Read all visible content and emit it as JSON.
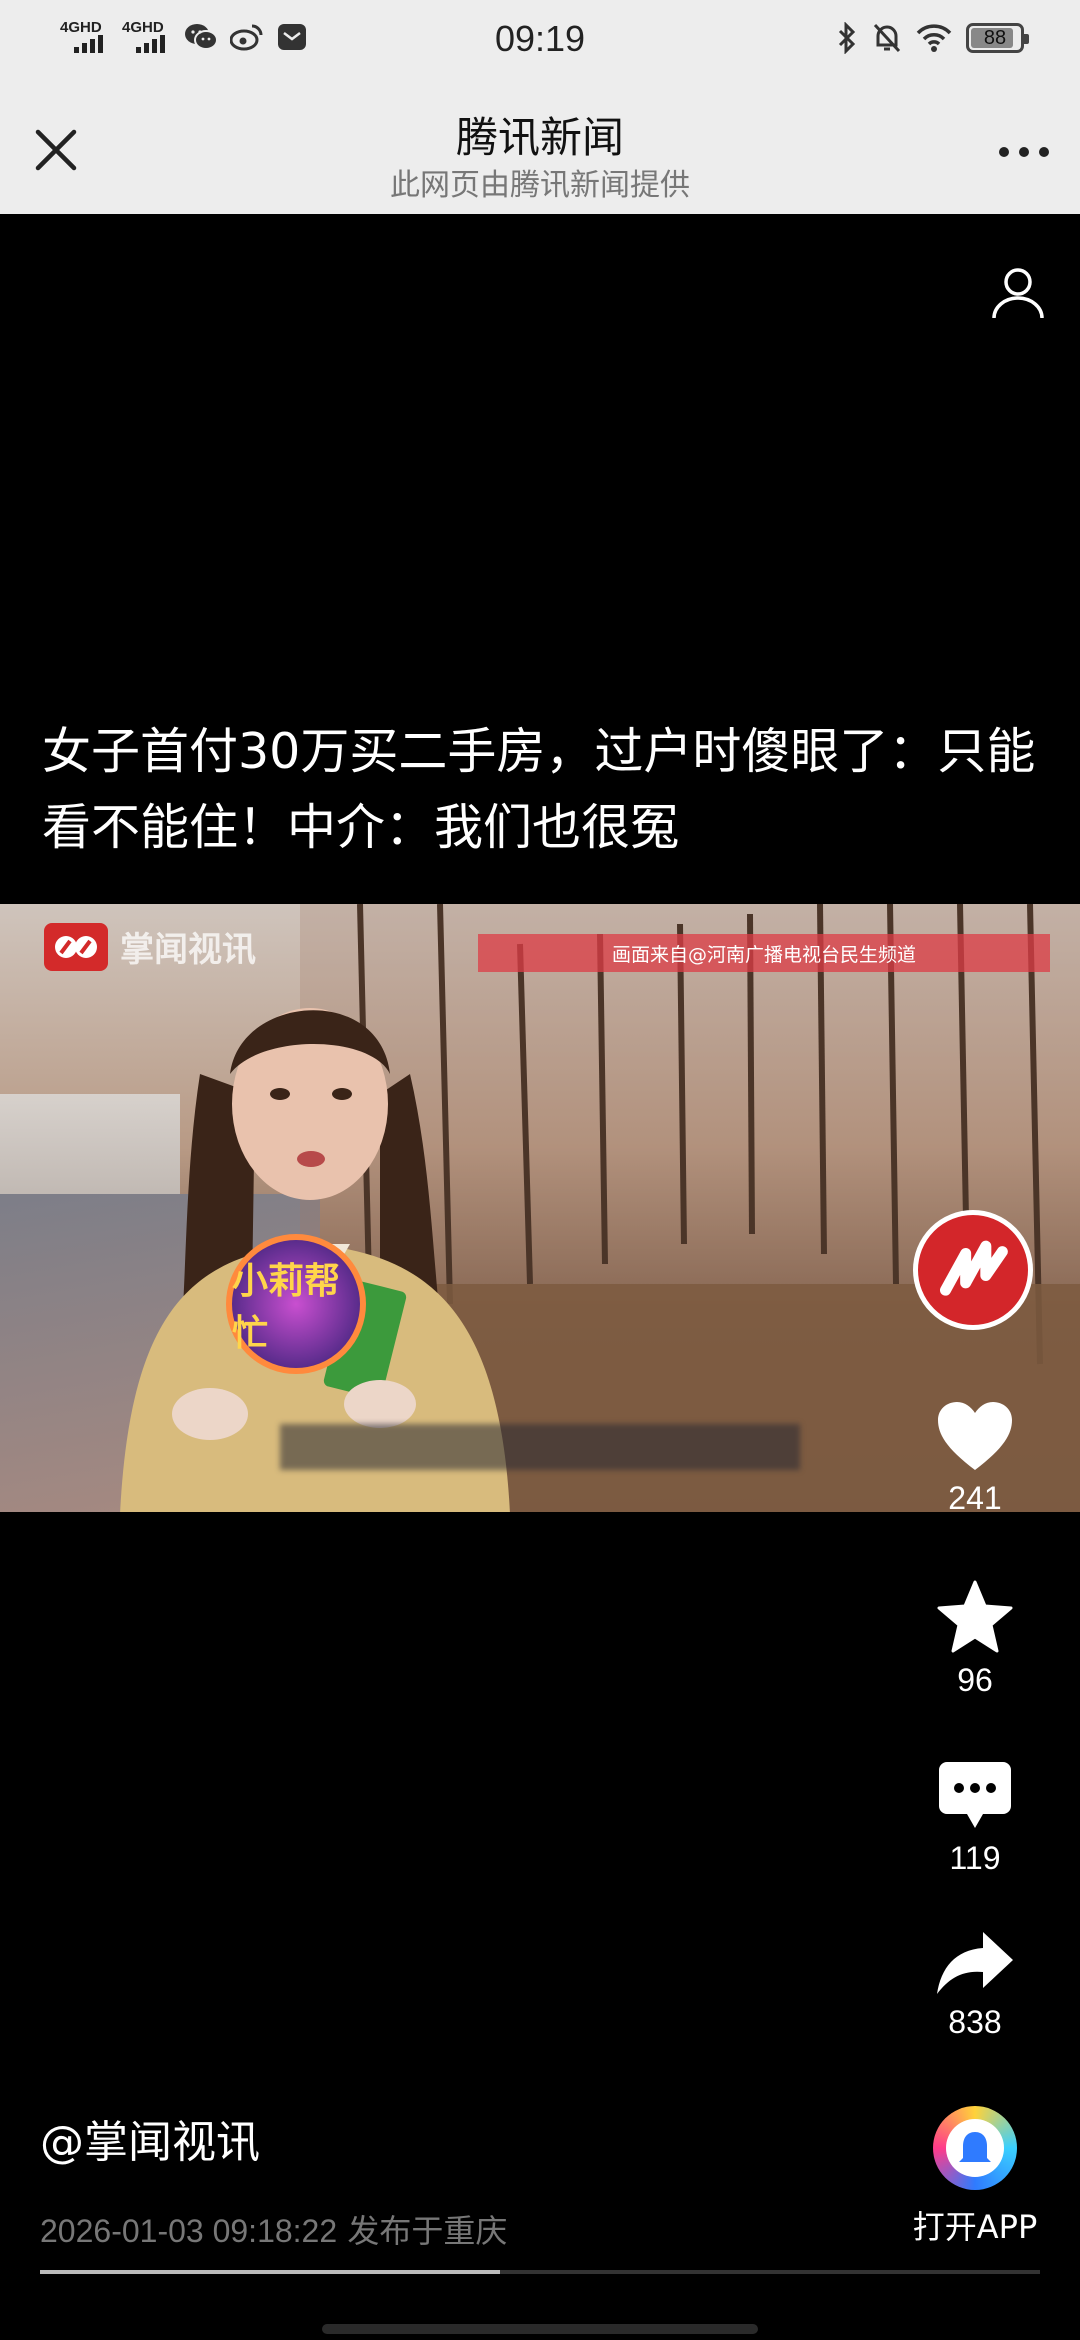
{
  "status_bar": {
    "time": "09:19",
    "signal_1": "4GHD",
    "signal_2": "4GHD",
    "battery": "88",
    "left_icons": [
      "wechat-icon",
      "weibo-icon",
      "message-icon"
    ],
    "right_icons": [
      "bluetooth-icon",
      "mute-icon",
      "wifi-icon",
      "battery-icon"
    ]
  },
  "nav": {
    "title": "腾讯新闻",
    "subtitle": "此网页由腾讯新闻提供"
  },
  "article": {
    "headline": "女子首付30万买二手房，过户时傻眼了：只能看不能住！中介：我们也很冤",
    "author": "@掌闻视讯",
    "date": "2026-01-03 09:18:22",
    "location": "发布于重庆"
  },
  "video": {
    "logo_text": "掌闻视讯",
    "source_banner": "画面来自@河南广播电视台民生频道",
    "badge_text": "小莉帮忙",
    "progress": 0.46
  },
  "actions": {
    "likes": "241",
    "favorites": "96",
    "comments": "119",
    "shares": "838",
    "open_app": "打开APP"
  },
  "colors": {
    "accent_red": "#d3262a",
    "nav_bg": "#ededed",
    "content_bg": "#000000"
  }
}
